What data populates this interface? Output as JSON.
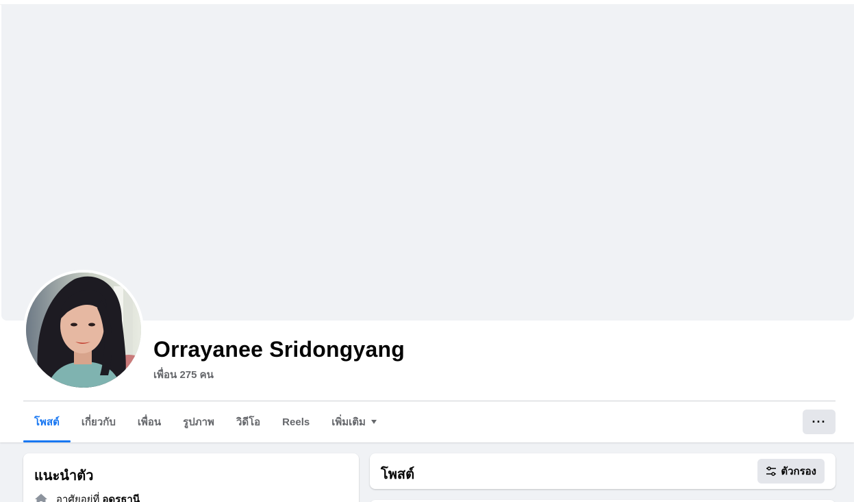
{
  "profile": {
    "name": "Orrayanee Sridongyang",
    "friends_count": "เพื่อน 275 คน"
  },
  "tabs": [
    {
      "label": "โพสต์",
      "active": true
    },
    {
      "label": "เกี่ยวกับ",
      "active": false
    },
    {
      "label": "เพื่อน",
      "active": false
    },
    {
      "label": "รูปภาพ",
      "active": false
    },
    {
      "label": "วิดีโอ",
      "active": false
    },
    {
      "label": "Reels",
      "active": false
    },
    {
      "label": "เพิ่มเติม",
      "active": false
    }
  ],
  "more_button": {
    "label": "···",
    "icon": "ellipsis-icon"
  },
  "intro": {
    "title": "แนะนำตัว",
    "lives_in_prefix": "อาศัยอยู่ที่",
    "lives_in_place": "อุดรธานี",
    "icon": "home-icon"
  },
  "posts": {
    "title": "โพสต์",
    "filter_label": "ตัวกรอง",
    "filter_icon": "filter-sliders-icon"
  },
  "colors": {
    "accent": "#1877f2",
    "cover": "#f0f2f5",
    "button_bg": "#e4e6eb",
    "muted_text": "#65676b"
  }
}
